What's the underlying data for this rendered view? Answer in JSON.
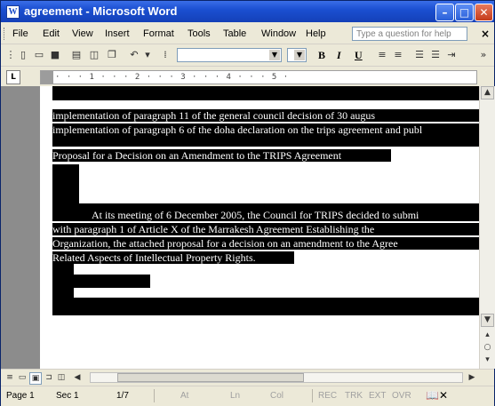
{
  "window": {
    "title": "agreement - Microsoft Word",
    "app_icon": "word-doc-icon",
    "controls": [
      "minimize-icon",
      "maximize-icon",
      "close-icon"
    ]
  },
  "menu": {
    "items": [
      "File",
      "Edit",
      "View",
      "Insert",
      "Format",
      "Tools",
      "Table",
      "Window",
      "Help"
    ],
    "help_box_placeholder": "Type a question for help",
    "close_doc": "×"
  },
  "toolbar": {
    "bold": "B",
    "italic": "I",
    "underline": "U"
  },
  "ruler": {
    "marks": "· · · 1 · · · 2 · · · 3 · · · 4 · · · 5 ·"
  },
  "document": {
    "lines": [
      "implementation of paragraph 11 of the general council decision of 30 augus",
      "implementation of paragraph 6 of the doha declaration on the trips agreement and publ",
      "Proposal for a Decision on an Amendment to the TRIPS Agreement",
      "At its meeting of 6 December 2005, the Council for TRIPS decided to submi",
      "with paragraph 1 of Article X of the Marrakesh Agreement Establishing the",
      "Organization, the attached proposal for a decision on an amendment to the Agree",
      "Related Aspects of Intellectual Property Rights."
    ],
    "highlight_color": "#000000",
    "text_color": "#ffffff"
  },
  "status": {
    "page": "Page 1",
    "section": "Sec 1",
    "pages": "1/7",
    "at": "At",
    "ln": "Ln",
    "col": "Col",
    "rec": "REC",
    "trk": "TRK",
    "ext": "EXT",
    "ovr": "OVR"
  }
}
